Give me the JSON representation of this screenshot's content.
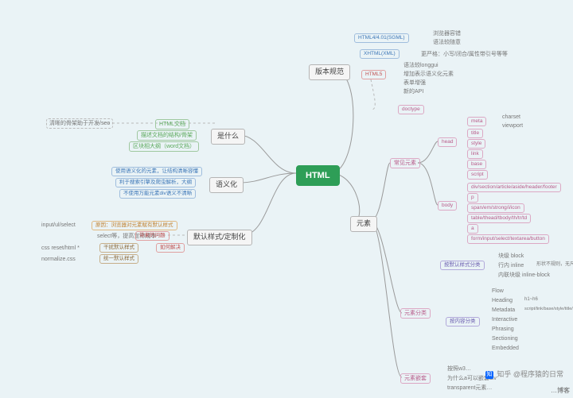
{
  "root": {
    "label": "HTML"
  },
  "left": {
    "shishenme": {
      "label": "是什么",
      "items": [
        "HTML文档",
        "描述文档的结构/骨架",
        "区块相大纲（word文档）"
      ],
      "note": "清晰的骨架助于开发/seo"
    },
    "yuyihua": {
      "label": "语义化",
      "items": [
        "使用语义化的元素，让结构清晰容懂",
        "利于搜索引擎及爬虫解析，大纲",
        "不使用万能元素div语义不清晰"
      ]
    },
    "moren": {
      "label": "默认样式/定制化",
      "yuanyin": {
        "label": "原因：浏览器对元素赋有默认样式",
        "sub": "select等，提高宣称成本"
      },
      "daichu": {
        "label": "带来的问题",
        "sub": "input/ul/select"
      },
      "ganrao": {
        "label": "干扰默认样式",
        "sub": "css reset/html *"
      },
      "tongyi": {
        "label": "统一默认样式",
        "sub": "normalize.css"
      },
      "ruhe": {
        "label": "如何解决"
      }
    }
  },
  "right": {
    "banben": {
      "label": "版本规范",
      "rows": [
        {
          "k": "HTML4/4.01(SGML)",
          "v": [
            "浏览器容错",
            "语法较随意"
          ]
        },
        {
          "k": "XHTML(XML)",
          "v": [
            "更严格：小写/闭合/属性带引号等等"
          ]
        },
        {
          "k": "HTML5",
          "v": [
            "语法较longgui",
            "增加表示语义化元素",
            "表单增强",
            "新的API"
          ]
        }
      ]
    },
    "doctype": {
      "label": "doctype"
    },
    "yuansu": {
      "label": "元素"
    },
    "changjian": {
      "label": "常见元素",
      "head": {
        "label": "head",
        "meta": {
          "label": "meta",
          "sub": [
            "charset",
            "viewport"
          ]
        },
        "items": [
          "title",
          "style",
          "link",
          "base",
          "script"
        ]
      },
      "body": {
        "label": "body",
        "items": [
          "div/section/article/aside/header/footer",
          "p",
          "span/em/strong/i/icon",
          "table/thead/tbody/th/tr/td",
          "a",
          "form/input/select/textarea/button"
        ]
      }
    },
    "fenlei": {
      "label": "元素分类",
      "moshi": {
        "label": "按默认样式分类",
        "rows": [
          {
            "k": "块级 block",
            "v": ""
          },
          {
            "k": "行内 inline",
            "v": "形状不规则，无尺寸"
          },
          {
            "k": "内联块级 inline-block",
            "v": ""
          }
        ]
      },
      "neirong": {
        "label": "按内容分类",
        "rows": [
          {
            "k": "Flow",
            "v": ""
          },
          {
            "k": "Heading",
            "v": "h1~h6"
          },
          {
            "k": "Metadata",
            "v": "script/link/base/style/title/template"
          },
          {
            "k": "Interactive",
            "v": ""
          },
          {
            "k": "Phrasing",
            "v": ""
          },
          {
            "k": "Sectioning",
            "v": ""
          },
          {
            "k": "Embedded",
            "v": ""
          }
        ]
      }
    },
    "qiantao": {
      "label": "元素嵌套",
      "rows": [
        "按照w3…",
        "为什么a可以嵌套div",
        "transparent元素…"
      ]
    }
  },
  "wm": {
    "zh": "知乎 @程序猿的日常",
    "csdn": "…博客"
  }
}
